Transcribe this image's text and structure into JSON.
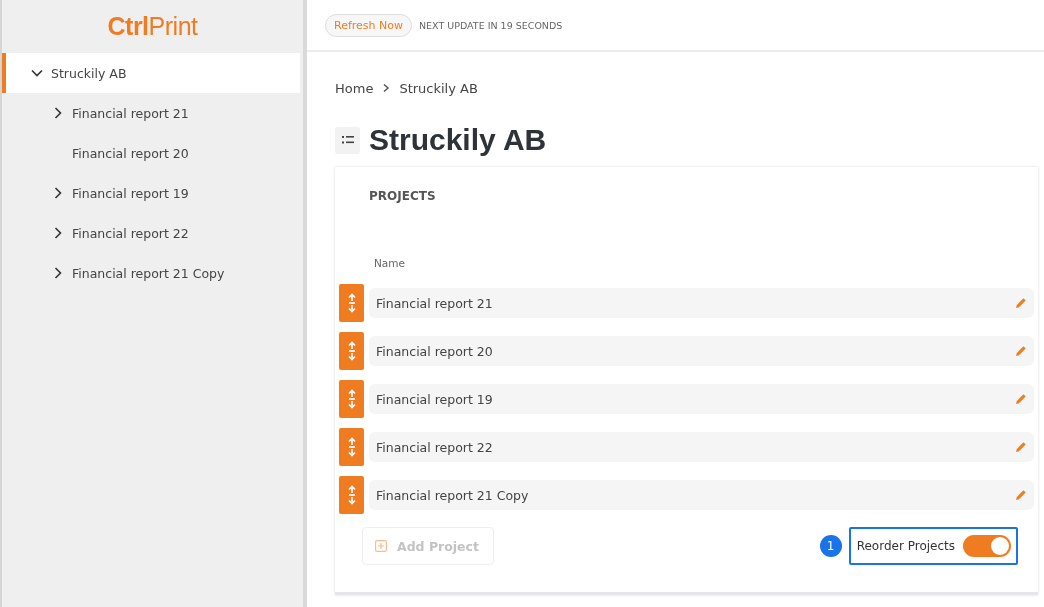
{
  "logo": {
    "text": "**Ctrl**Print"
  },
  "sidebar": {
    "items": [
      {
        "label": "Struckily AB",
        "kind": "branch",
        "expanded": true,
        "selected": true,
        "children": [
          {
            "label": "Financial report 21",
            "kind": "branch",
            "expanded": false,
            "selected": false
          },
          {
            "label": "Financial report 20",
            "kind": "leaf",
            "selected": false
          },
          {
            "label": "Financial report 19",
            "kind": "branch",
            "expanded": false,
            "selected": false
          },
          {
            "label": "Financial report 22",
            "kind": "branch",
            "expanded": false,
            "selected": false
          },
          {
            "label": "Financial report 21 Copy",
            "kind": "branch",
            "expanded": false,
            "selected": false
          }
        ]
      }
    ]
  },
  "topbar": {
    "refresh_button": "Refresh Now",
    "update_text": "NEXT UPDATE IN 19 SECONDS"
  },
  "breadcrumb": [
    "Home",
    "Struckily AB"
  ],
  "page_title": "Struckily AB",
  "projects": {
    "heading": "PROJECTS",
    "column": "Name",
    "rows": [
      {
        "name": "Financial report 21"
      },
      {
        "name": "Financial report 20"
      },
      {
        "name": "Financial report 19"
      },
      {
        "name": "Financial report 22"
      },
      {
        "name": "Financial report 21 Copy"
      }
    ],
    "add_button": {
      "label": "Add Project",
      "disabled": true
    },
    "step_badge": "1",
    "reorder_toggle": {
      "label": "Reorder Projects",
      "on": true,
      "highlighted": true
    }
  }
}
